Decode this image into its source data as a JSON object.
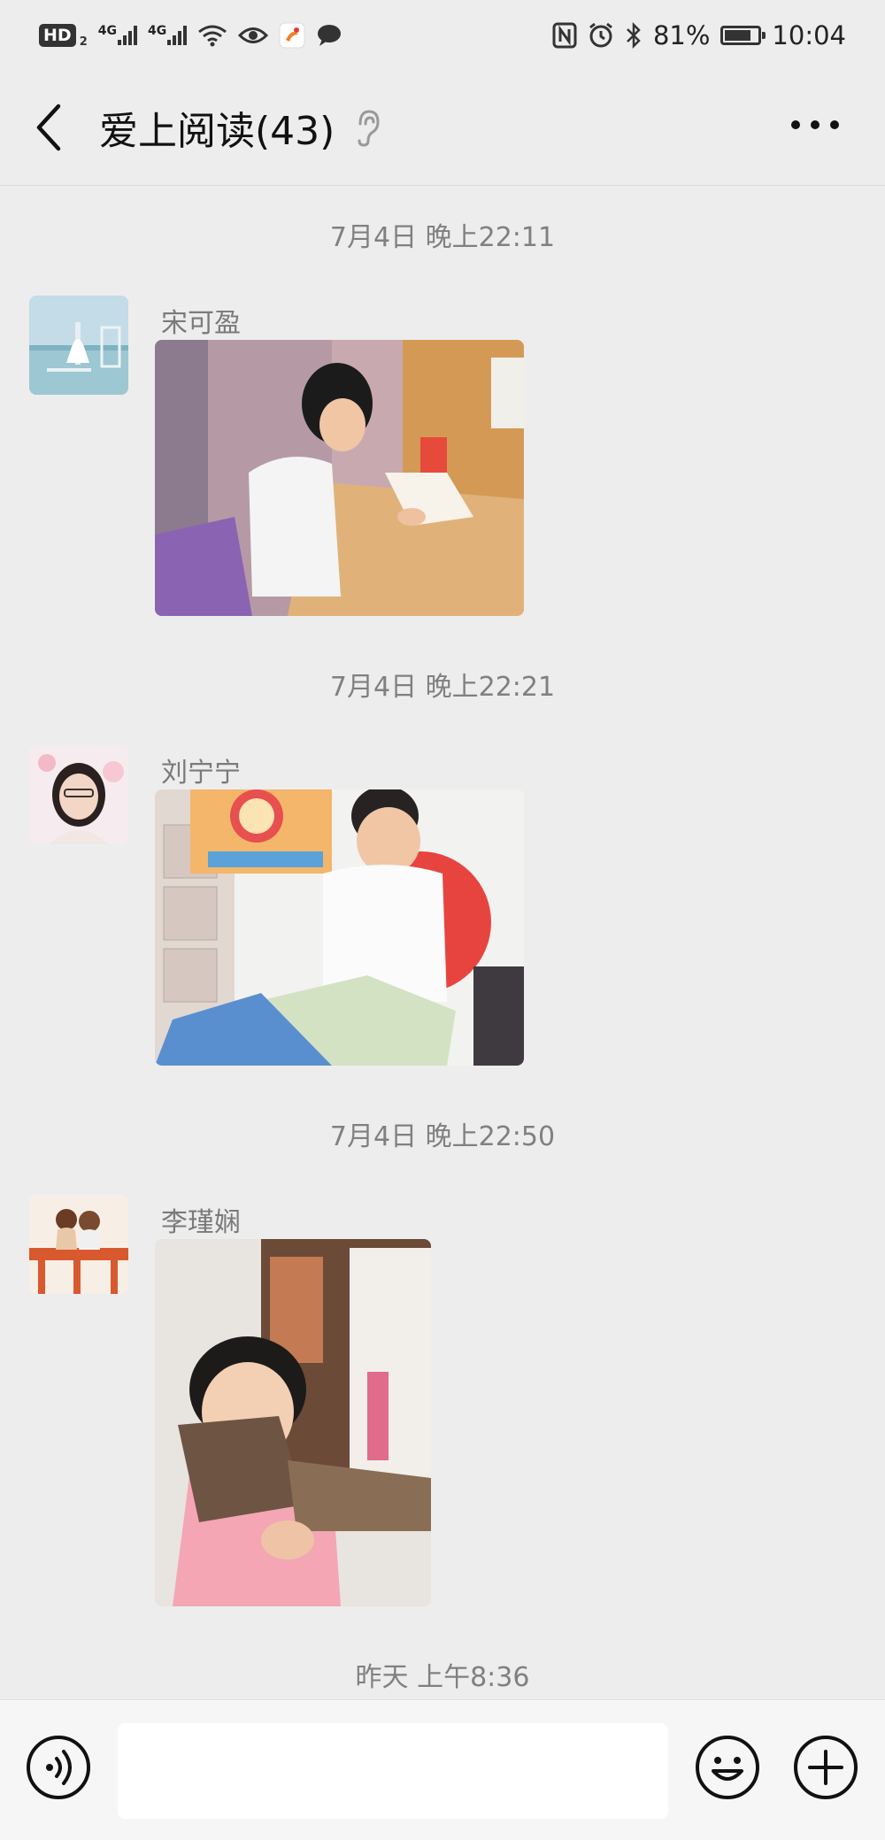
{
  "status_bar": {
    "hd": "HD",
    "hd_sub": "2",
    "net_label_1": "4G",
    "net_label_2": "4G",
    "battery_text": "81%",
    "battery_level": 0.81,
    "time": "10:04"
  },
  "nav": {
    "title": "爱上阅读(43)"
  },
  "messages": [
    {
      "time": "7月4日 晚上22:11",
      "sender": "宋可盈"
    },
    {
      "time": "7月4日 晚上22:21",
      "sender": "刘宁宁"
    },
    {
      "time": "7月4日 晚上22:50",
      "sender": "李瑾娴"
    }
  ],
  "last_time": "昨天 上午8:36",
  "input": {
    "value": ""
  },
  "icons": {
    "back": "chevron-left-icon",
    "mute": "ear-icon",
    "more": "more-dots-icon",
    "voice": "voice-icon",
    "emoji": "smiley-icon",
    "plus": "plus-icon"
  }
}
